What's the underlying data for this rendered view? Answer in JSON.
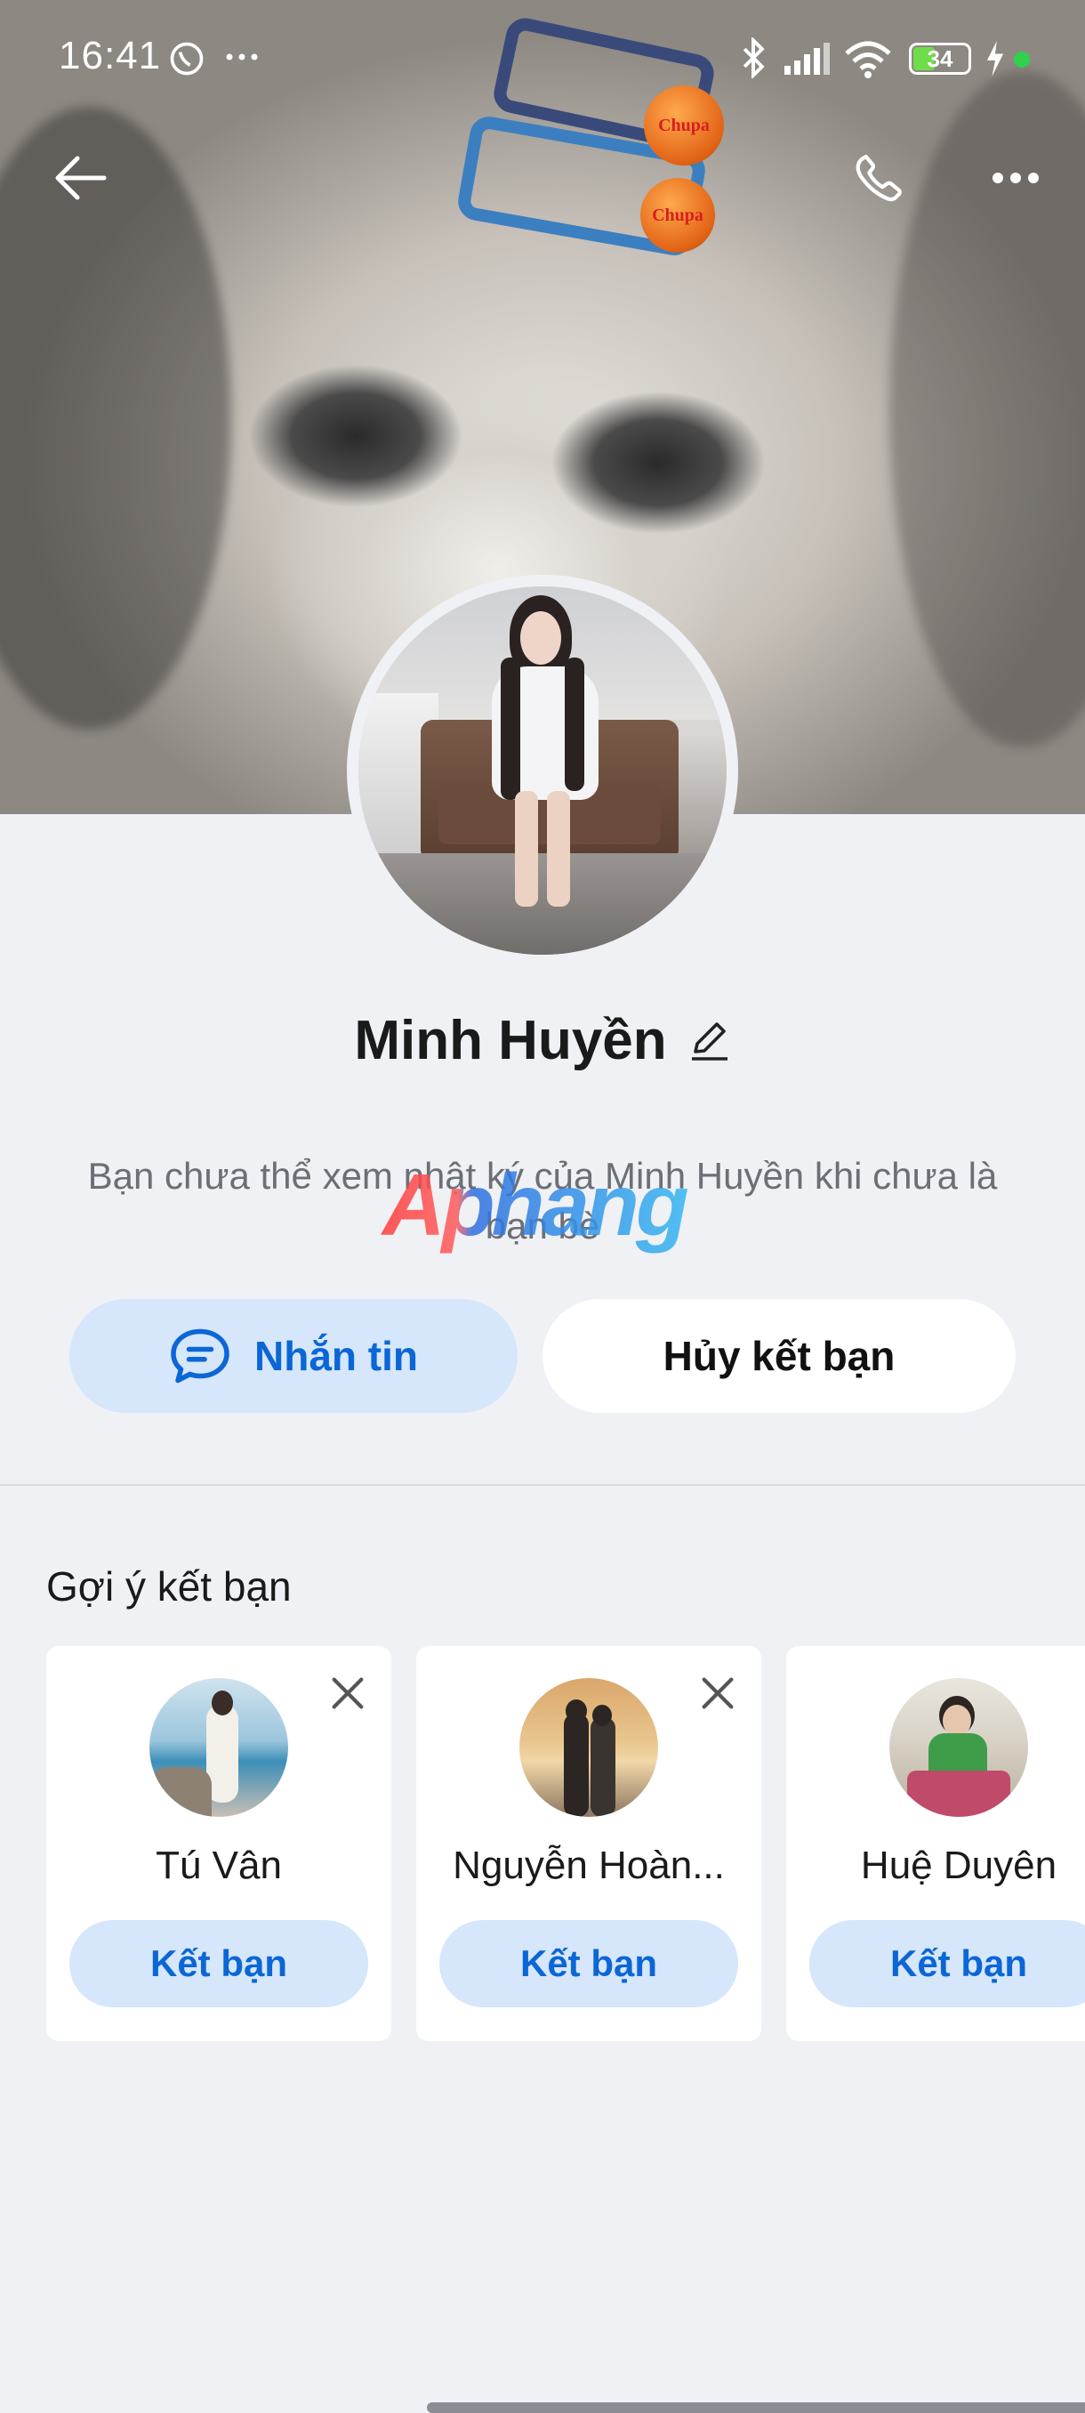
{
  "status_bar": {
    "time": "16:41",
    "battery": "34"
  },
  "profile": {
    "name": "Minh Huyền",
    "note": "Bạn chưa thể xem nhật ký của Minh Huyền khi chưa là bạn bè"
  },
  "watermark": {
    "text": "Aphang"
  },
  "actions": {
    "message_label": "Nhắn tin",
    "unfriend_label": "Hủy kết bạn"
  },
  "suggestions": {
    "title": "Gợi ý kết bạn",
    "items": [
      {
        "name": "Tú Vân",
        "button": "Kết bạn"
      },
      {
        "name": "Nguyễn Hoàn...",
        "button": "Kết bạn"
      },
      {
        "name": "Huệ Duyên",
        "button": "Kết bạn"
      }
    ]
  },
  "colors": {
    "accent": "#0b66d6",
    "accent_bg": "#d6e6fb",
    "page_bg": "#eff1f5"
  }
}
